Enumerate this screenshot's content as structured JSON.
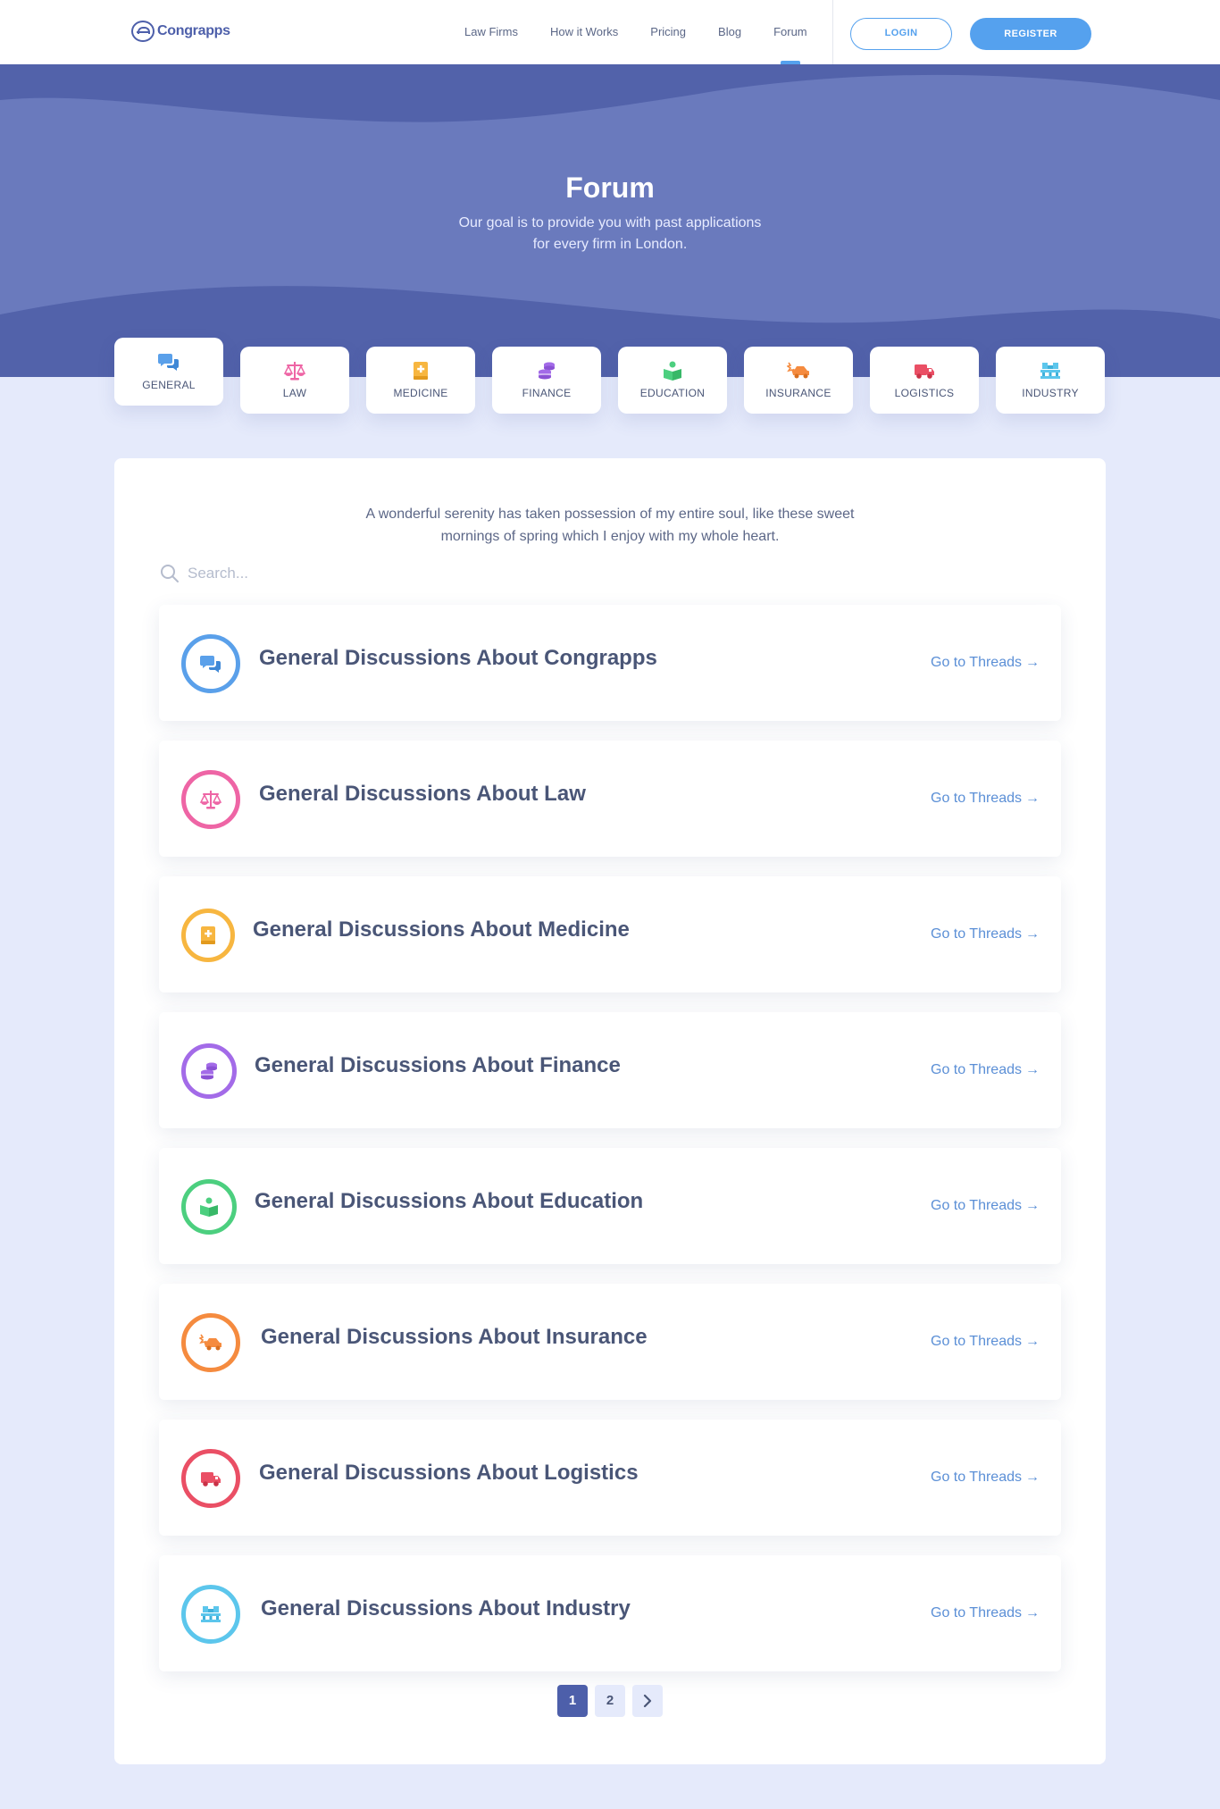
{
  "brand": {
    "name": "Congrapps"
  },
  "nav": {
    "links": [
      "Law Firms",
      "How it Works",
      "Pricing",
      "Blog",
      "Forum"
    ],
    "active": "Forum",
    "login_label": "LOGIN",
    "register_label": "REGISTER"
  },
  "hero": {
    "title": "Forum",
    "subtitle_line1": "Our goal is to provide you with past applications",
    "subtitle_line2": "for every firm in London."
  },
  "categories": [
    {
      "label": "GENERAL",
      "icon": "chat-bubbles-icon",
      "color": "#5aa0ea",
      "active": true
    },
    {
      "label": "LAW",
      "icon": "scales-icon",
      "color": "#ee65a5"
    },
    {
      "label": "MEDICINE",
      "icon": "medical-book-icon",
      "color": "#f7b640"
    },
    {
      "label": "FINANCE",
      "icon": "coins-stack-icon",
      "color": "#a36be8"
    },
    {
      "label": "EDUCATION",
      "icon": "open-book-icon",
      "color": "#4ccf7f"
    },
    {
      "label": "INSURANCE",
      "icon": "car-crash-icon",
      "color": "#f58b3f"
    },
    {
      "label": "LOGISTICS",
      "icon": "truck-icon",
      "color": "#ea4f65"
    },
    {
      "label": "INDUSTRY",
      "icon": "pallet-boxes-icon",
      "color": "#5cc6ec"
    }
  ],
  "main": {
    "intro_line1": "A wonderful serenity has taken possession of my entire soul, like these sweet",
    "intro_line2": "mornings of spring which I enjoy with my whole heart.",
    "search_placeholder": "Search...",
    "forums": [
      {
        "title": "General Discussions About Congrapps",
        "link": "Go to Threads",
        "icon": "chat-bubbles-icon",
        "color": "#5aa0ea"
      },
      {
        "title": "General Discussions About Law",
        "link": "Go to Threads",
        "icon": "scales-icon",
        "color": "#ee65a5"
      },
      {
        "title": "General Discussions About Medicine",
        "link": "Go to Threads",
        "icon": "medical-book-icon",
        "color": "#f7b640"
      },
      {
        "title": "General Discussions About Finance",
        "link": "Go to Threads",
        "icon": "coins-stack-icon",
        "color": "#a36be8"
      },
      {
        "title": "General Discussions About Education",
        "link": "Go to Threads",
        "icon": "open-book-icon",
        "color": "#4ccf7f"
      },
      {
        "title": "General Discussions About Insurance",
        "link": "Go to Threads",
        "icon": "car-crash-icon",
        "color": "#f58b3f"
      },
      {
        "title": "General Discussions About Logistics",
        "link": "Go to Threads",
        "icon": "truck-icon",
        "color": "#ea4f65"
      },
      {
        "title": "General Discussions About Industry",
        "link": "Go to Threads",
        "icon": "pallet-boxes-icon",
        "color": "#5cc6ec"
      }
    ],
    "pagination": {
      "pages": [
        "1",
        "2"
      ],
      "current": "1",
      "next_label": "›"
    }
  },
  "colors": {
    "primary": "#4d5faa",
    "accent": "#55a1ee",
    "hero_bg": "#6a7abd",
    "page_bg": "#e5eafb"
  }
}
